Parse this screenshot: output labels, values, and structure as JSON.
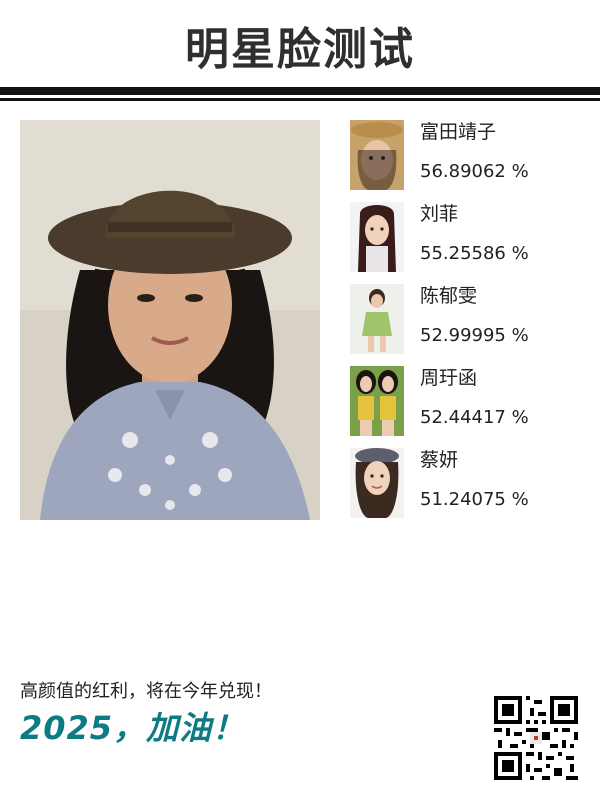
{
  "header": {
    "title": "明星脸测试"
  },
  "main_photo": {
    "icon": "user-photo"
  },
  "matches": [
    {
      "name": "富田靖子",
      "percent": "56.89062 %",
      "icon": "celebrity-photo"
    },
    {
      "name": "刘菲",
      "percent": "55.25586 %",
      "icon": "celebrity-photo"
    },
    {
      "name": "陈郁雯",
      "percent": "52.99995 %",
      "icon": "celebrity-photo"
    },
    {
      "name": "周玗函",
      "percent": "52.44417 %",
      "icon": "celebrity-photo"
    },
    {
      "name": "蔡妍",
      "percent": "51.24075 %",
      "icon": "celebrity-photo"
    }
  ],
  "footer": {
    "line": "高颜值的红利，将在今年兑现！",
    "slogan": "2025，加油！",
    "qr_icon": "qr-code-icon"
  },
  "colors": {
    "accent": "#0e7b84",
    "rule": "#111111"
  }
}
